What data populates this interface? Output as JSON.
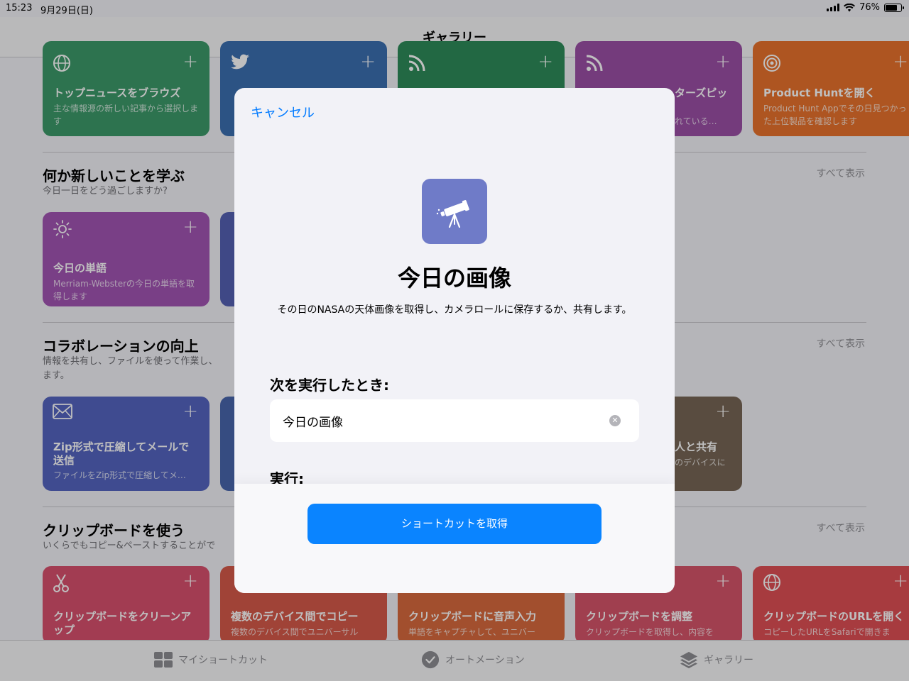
{
  "status": {
    "time": "15:23",
    "date": "9月29日(日)",
    "battery": "76%",
    "battery_level": 0.76
  },
  "nav": {
    "title": "ギャラリー"
  },
  "top_cards": [
    {
      "title": "トップニュースをブラウズ",
      "subtitle": "主な情報源の新しい記事から選択します",
      "icon": "globe-icon",
      "color": "#3c9a6a"
    },
    {
      "title": "",
      "subtitle": "",
      "icon": "twitter-icon",
      "color": "#3b6fb0"
    },
    {
      "title": "",
      "subtitle": "",
      "icon": "rss-icon",
      "color": "#2e8b5a"
    },
    {
      "title": "ターズピッ",
      "subtitle": "れている…",
      "icon": "rss-icon",
      "color": "#9b4fa6"
    },
    {
      "title": "Product Huntを開く",
      "subtitle": "Product Hunt Appでその日見つかった上位製品を確認します",
      "icon": "target-icon",
      "color": "#e8722d"
    }
  ],
  "sections": [
    {
      "title": "何か新しいことを学ぶ",
      "subtitle": "今日一日をどう過ごしますか?",
      "see_all": "すべて表示",
      "card": {
        "title": "今日の単語",
        "subtitle": "Merriam-Websterの今日の単語を取得します",
        "icon": "sun-icon",
        "color": "#a254b3"
      }
    },
    {
      "title": "コラボレーションの向上",
      "subtitle": "情報を共有し、ファイルを使って作業し、",
      "subtitle2": "ます。",
      "see_all": "すべて表示",
      "card": {
        "title": "Zip形式で圧縮してメールで送信",
        "subtitle": "ファイルをZip形式で圧縮してメ…",
        "icon": "mail-icon",
        "color": "#5565c0"
      },
      "right_card": {
        "title": "人と共有",
        "subtitle": "のデバイスに",
        "color": "#776656"
      }
    },
    {
      "title": "クリップボードを使う",
      "subtitle": "いくらでもコピー&ペーストすることがで",
      "see_all": "すべて表示"
    }
  ],
  "bottom_cards": [
    {
      "title": "クリップボードをクリーンアップ",
      "subtitle": "",
      "icon": "scissors-icon",
      "color": "#d9506e"
    },
    {
      "title": "複数のデバイス間でコピー",
      "subtitle": "複数のデバイス間でユニバーサル",
      "icon": "",
      "color": "#d65a4a"
    },
    {
      "title": "クリップボードに音声入力",
      "subtitle": "単語をキャプチャして、ユニバー",
      "icon": "",
      "color": "#d86a3e"
    },
    {
      "title": "クリップボードを調整",
      "subtitle": "クリップボードを取得し、内容を",
      "icon": "",
      "color": "#d6546a"
    },
    {
      "title": "クリップボードのURLを開く",
      "subtitle": "コピーしたURLをSafariで開きま",
      "icon": "globe-icon",
      "color": "#df4f55"
    }
  ],
  "tabs": [
    {
      "label": "マイショートカット",
      "icon": "grid-icon"
    },
    {
      "label": "オートメーション",
      "icon": "checkmark-icon"
    },
    {
      "label": "ギャラリー",
      "icon": "layers-icon"
    }
  ],
  "modal": {
    "cancel": "キャンセル",
    "icon": "telescope-icon",
    "icon_color": "#6f7bc8",
    "title": "今日の画像",
    "description": "その日のNASAの天体画像を取得し、カメラロールに保存するか、共有します。",
    "trigger_label": "次を実行したとき:",
    "trigger_value": "今日の画像",
    "run_label": "実行:",
    "button": "ショートカットを取得",
    "button_color": "#0a84ff"
  }
}
